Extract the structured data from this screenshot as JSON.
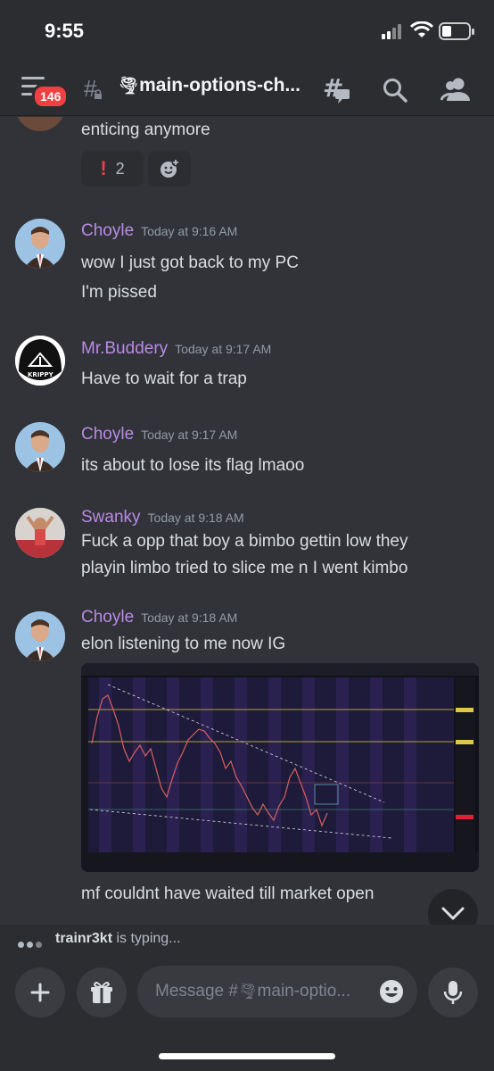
{
  "status": {
    "time": "9:55"
  },
  "header": {
    "badge_count": "146",
    "channel_name": "main-options-ch..."
  },
  "messages": [
    {
      "text": "enticing anymore",
      "reactions": [
        {
          "emoji": "❗",
          "count": "2"
        }
      ]
    },
    {
      "author": "Choyle",
      "time": "Today at 9:16 AM",
      "lines": [
        "wow I just got back to my PC",
        "I'm pissed"
      ]
    },
    {
      "author": "Mr.Buddery",
      "time": "Today at 9:17 AM",
      "lines": [
        "Have to wait for a trap"
      ]
    },
    {
      "author": "Choyle",
      "time": "Today at 9:17 AM",
      "lines": [
        "its about to lose its flag lmaoo"
      ]
    },
    {
      "author": "Swanky",
      "time": "Today at 9:18 AM",
      "lines": [
        "Fuck a opp that boy a bimbo gettin low they",
        "playin limbo tried to slice me n I went kimbo"
      ]
    },
    {
      "author": "Choyle",
      "time": "Today at 9:18 AM",
      "lines": [
        "elon listening to me now IG",
        "mf couldnt have waited till market open"
      ]
    }
  ],
  "avatar_label_krippy": "KRIPPY",
  "typing": {
    "user": "trainr3kt",
    "suffix": "is typing..."
  },
  "composer": {
    "placeholder": "Message #",
    "placeholder_channel": "main-optio..."
  },
  "colors": {
    "accent_name": "#b98ae6",
    "badge": "#f23f43"
  }
}
